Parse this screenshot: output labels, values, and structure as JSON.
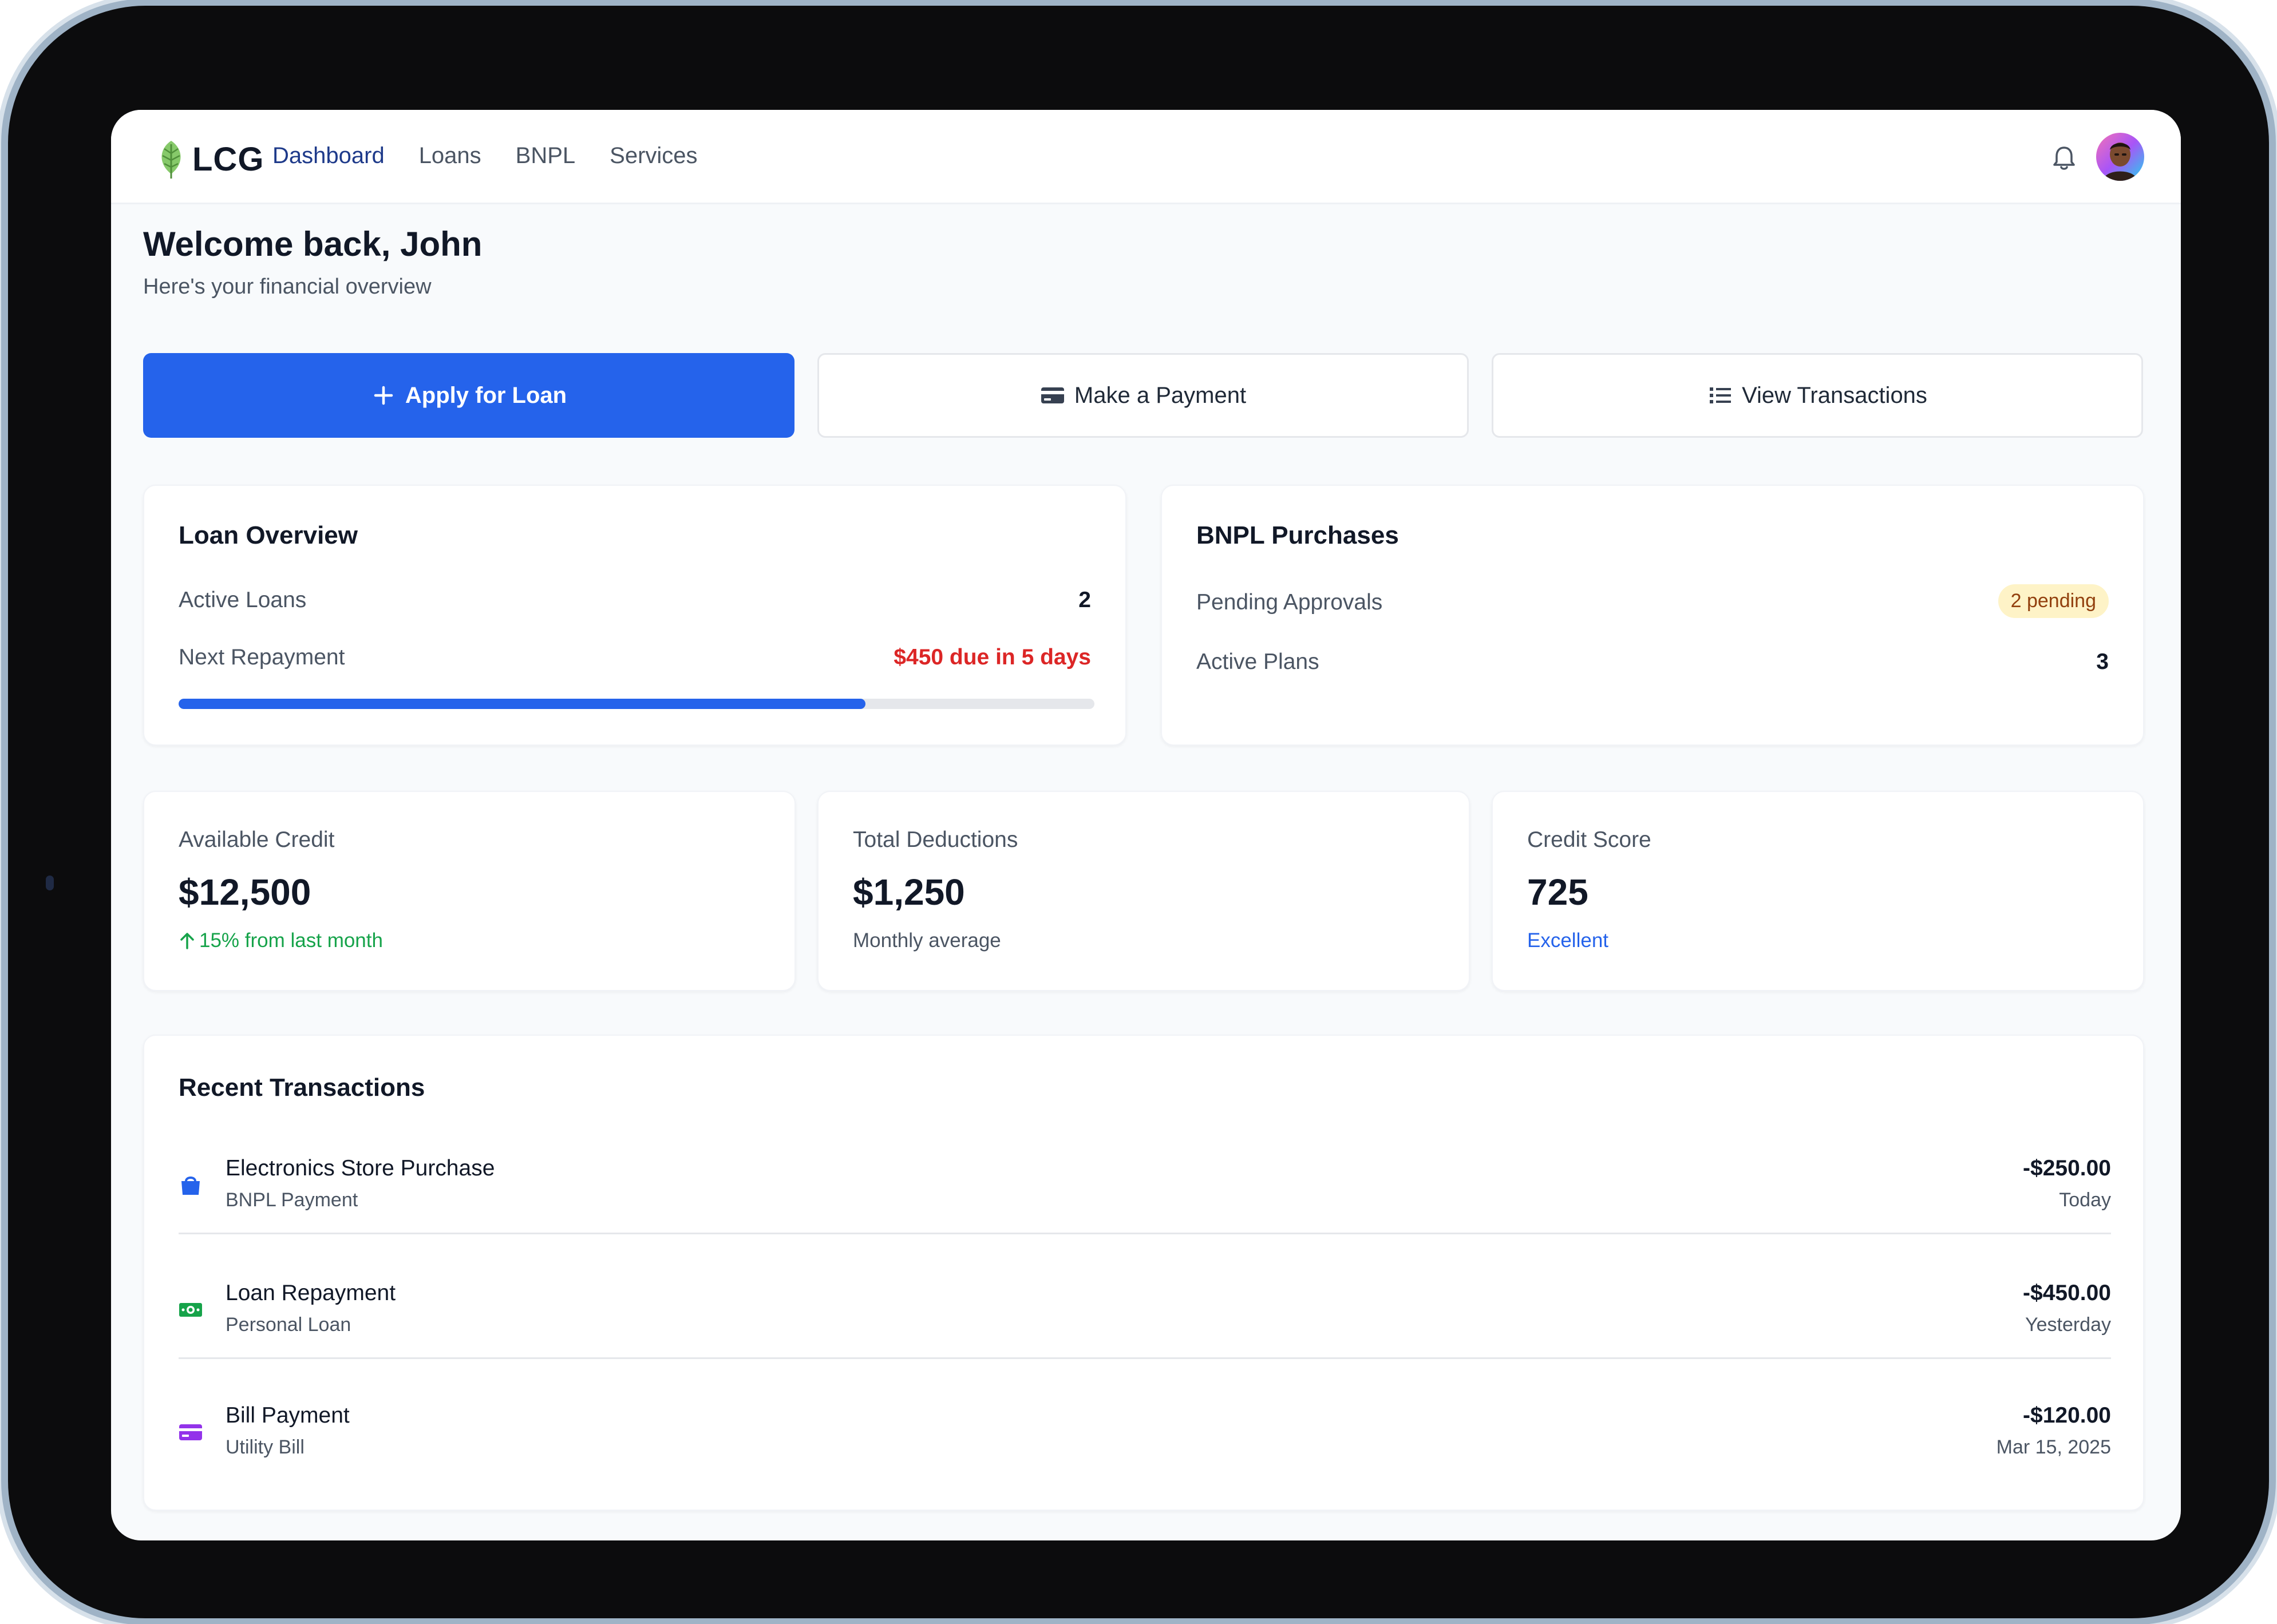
{
  "brand": {
    "name": "LCG"
  },
  "nav": {
    "items": [
      {
        "label": "Dashboard",
        "active": true
      },
      {
        "label": "Loans",
        "active": false
      },
      {
        "label": "BNPL",
        "active": false
      },
      {
        "label": "Services",
        "active": false
      }
    ]
  },
  "header": {
    "icons": [
      "bell-icon",
      "avatar"
    ]
  },
  "welcome": {
    "title": "Welcome back, John",
    "subtitle": "Here's your financial overview"
  },
  "actions": {
    "apply_label": "Apply for Loan",
    "payment_label": "Make a Payment",
    "transactions_label": "View Transactions"
  },
  "loan_overview": {
    "title": "Loan Overview",
    "active_loans_label": "Active Loans",
    "active_loans_value": "2",
    "next_repayment_label": "Next Repayment",
    "next_repayment_value": "$450 due in 5 days",
    "repayment_progress": 0.75
  },
  "bnpl": {
    "title": "BNPL Purchases",
    "pending_label": "Pending Approvals",
    "pending_badge": "2 pending",
    "active_plans_label": "Active Plans",
    "active_plans_value": "3"
  },
  "stats": {
    "available_credit": {
      "label": "Available Credit",
      "value": "$12,500",
      "note": "15% from last month"
    },
    "total_deductions": {
      "label": "Total Deductions",
      "value": "$1,250",
      "note": "Monthly average"
    },
    "credit_score": {
      "label": "Credit Score",
      "value": "725",
      "note": "Excellent"
    }
  },
  "transactions": {
    "title": "Recent Transactions",
    "items": [
      {
        "title": "Electronics Store Purchase",
        "subtitle": "BNPL Payment",
        "amount": "-$250.00",
        "date": "Today",
        "icon": "shopping-bag-icon"
      },
      {
        "title": "Loan Repayment",
        "subtitle": "Personal Loan",
        "amount": "-$450.00",
        "date": "Yesterday",
        "icon": "money-bill-icon"
      },
      {
        "title": "Bill Payment",
        "subtitle": "Utility Bill",
        "amount": "-$120.00",
        "date": "Mar 15, 2025",
        "icon": "credit-card-icon"
      }
    ]
  },
  "colors": {
    "primary": "#2563eb",
    "danger": "#dc2626",
    "success": "#16a34a",
    "warning_bg": "#fef3c7"
  }
}
